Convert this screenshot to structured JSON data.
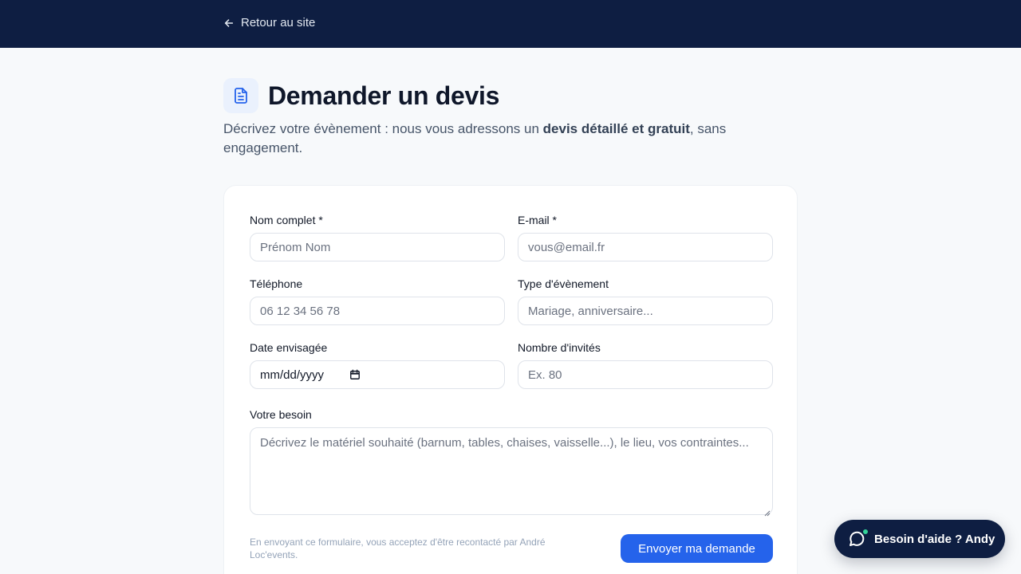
{
  "topbar": {
    "back_label": "Retour au site",
    "background": "#0e1e42"
  },
  "header": {
    "icon": "document-icon",
    "title": "Demander un devis",
    "subtitle_before": "Décrivez votre évènement : nous vous adressons un ",
    "subtitle_bold": "devis détaillé et gratuit",
    "subtitle_after": ", sans engagement."
  },
  "form": {
    "name": {
      "label": "Nom complet *",
      "placeholder": "Prénom Nom"
    },
    "email": {
      "label": "E-mail *",
      "placeholder": "vous@email.fr"
    },
    "phone": {
      "label": "Téléphone",
      "placeholder": "06 12 34 56 78"
    },
    "event_type": {
      "label": "Type d'évènement",
      "placeholder": "Mariage, anniversaire..."
    },
    "date": {
      "label": "Date envisagée",
      "value": "mm/dd/yyyy"
    },
    "guests": {
      "label": "Nombre d'invités",
      "placeholder": "Ex. 80"
    },
    "need": {
      "label": "Votre besoin",
      "placeholder": "Décrivez le matériel souhaité (barnum, tables, chaises, vaisselle...), le lieu, vos contraintes..."
    },
    "consent": "En envoyant ce formulaire, vous acceptez d'être recontacté par André Loc'events.",
    "submit_label": "Envoyer ma demande"
  },
  "help_widget": {
    "label": "Besoin d'aide ? Andy",
    "icon": "chat-bubble-icon",
    "status_color": "#34d399"
  },
  "colors": {
    "accent": "#2563eb",
    "navy": "#0e1e42",
    "page_bg": "#f7f9fb"
  }
}
